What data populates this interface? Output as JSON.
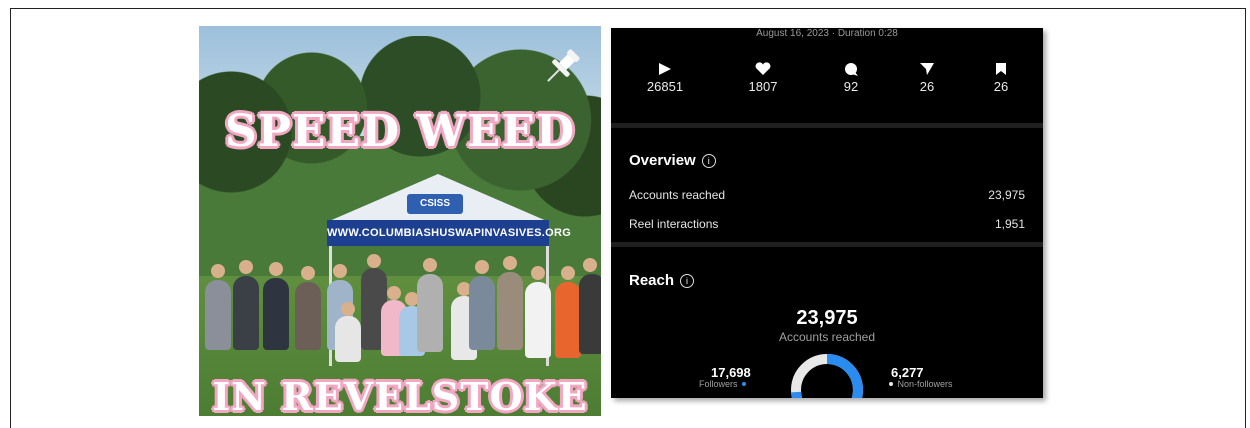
{
  "photo": {
    "title_top": "SPEED WEED",
    "title_bottom": "IN REVELSTOKE",
    "banner_text": "WWW.COLUMBIASHUSWAPINVASIVES.ORG",
    "logo_text": "CSISS"
  },
  "insights": {
    "date_line": "August 16, 2023 · Duration 0:28",
    "stats": [
      {
        "icon": "play-icon",
        "value": "26851"
      },
      {
        "icon": "heart-icon",
        "value": "1807"
      },
      {
        "icon": "comment-icon",
        "value": "92"
      },
      {
        "icon": "share-icon",
        "value": "26"
      },
      {
        "icon": "bookmark-icon",
        "value": "26"
      }
    ],
    "overview": {
      "title": "Overview",
      "rows": [
        {
          "label": "Accounts reached",
          "value": "23,975"
        },
        {
          "label": "Reel interactions",
          "value": "1,951"
        }
      ]
    },
    "reach": {
      "title": "Reach",
      "total": "23,975",
      "total_label": "Accounts reached",
      "followers_value": "17,698",
      "followers_label": "Followers",
      "nonfollowers_value": "6,277",
      "nonfollowers_label": "Non-followers",
      "followers_fraction": 0.738,
      "colors": {
        "followers": "#2b8cf0",
        "nonfollowers": "#e8e8e8"
      }
    }
  }
}
